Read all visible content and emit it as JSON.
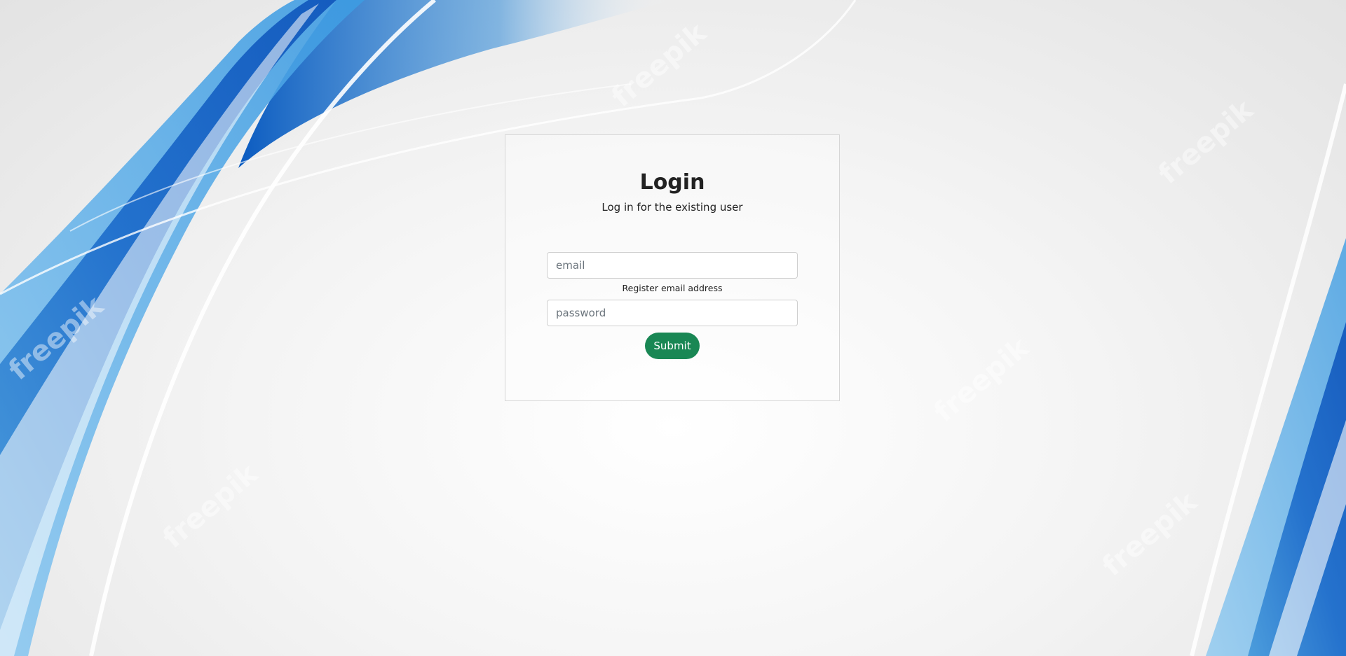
{
  "login": {
    "title": "Login",
    "subtitle": "Log in for the existing user",
    "email": {
      "placeholder": "email",
      "value": ""
    },
    "email_help": "Register email address",
    "password": {
      "placeholder": "password",
      "value": ""
    },
    "submit_label": "Submit"
  },
  "background": {
    "watermark_text": "freepik",
    "colors": {
      "wave_blue": "#1a73d1",
      "wave_light_blue": "#5ab4ee",
      "card_border": "#d6d6d6",
      "submit_green": "#198754"
    }
  }
}
